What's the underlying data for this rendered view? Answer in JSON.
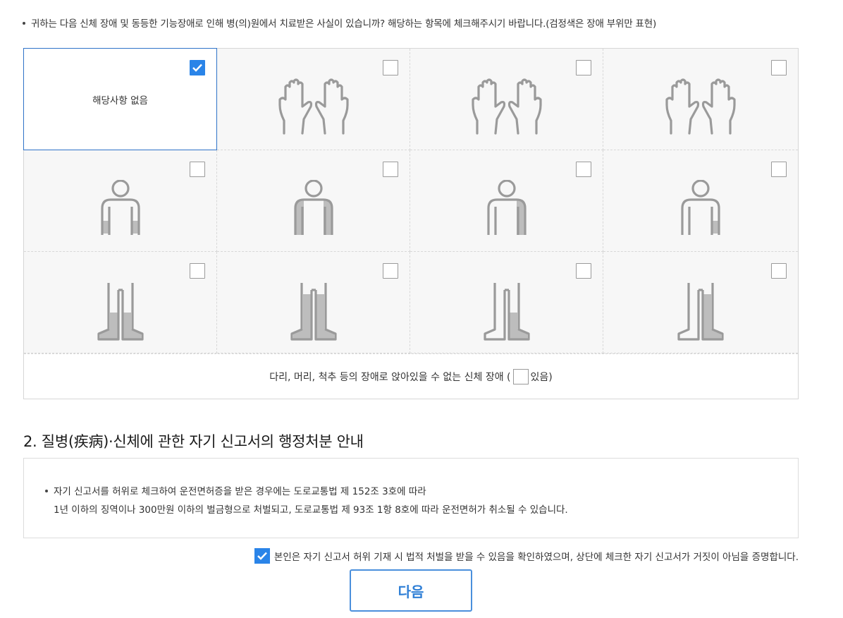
{
  "intro": {
    "text": "귀하는 다음 신체 장애 및 동등한 기능장애로 인해 병(의)원에서 치료받은 사실이 있습니까? 해당하는 항목에 체크해주시기 바랍니다.(검정색은 장애 부위만 표현)"
  },
  "grid": {
    "none_label": "해당사항 없음",
    "bottom_label_before": "다리, 머리, 척추 등의 장애로 앉아있을 수 없는 신체 장애 (",
    "bottom_label_after": "있음)"
  },
  "section": {
    "title": "2. 질병(疾病)·신체에 관한 자기 신고서의 행정처분 안내"
  },
  "notice": {
    "line1": "자기 신고서를 허위로 체크하여 운전면허증을 받은 경우에는 도로교통법 제 152조 3호에 따라",
    "line2": "1년 이하의 징역이나 300만원 이하의 벌금형으로 처벌되고, 도로교통법 제 93조 1항 8호에 따라 운전면허가 취소될 수 있습니다."
  },
  "confirm": {
    "text": "본인은 자기 신고서 허위 기재 시 법적 처벌을 받을 수 있음을 확인하였으며, 상단에 체크한 자기 신고서가 거짓이 아님을 증명합니다."
  },
  "buttons": {
    "next": "다음"
  },
  "colors": {
    "accent": "#2a84e8",
    "border_selected": "#2f73c8",
    "button_border": "#4a8fdc"
  }
}
